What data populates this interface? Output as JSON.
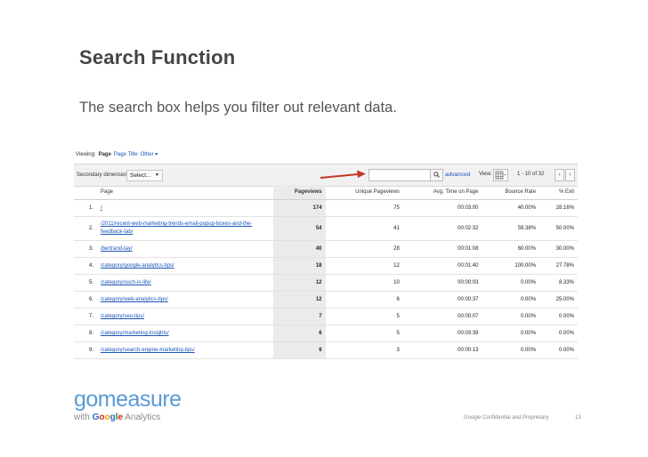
{
  "slide": {
    "title": "Search Function",
    "subtitle": "The search box helps you filter out relevant data."
  },
  "viewing": {
    "label": "Viewing:",
    "tab_page": "Page",
    "tab_page_title": "Page Title",
    "tab_other": "Other"
  },
  "filter_bar": {
    "secondary_dimension_label": "Secondary dimension:",
    "select_label": "Select...",
    "search_value": "",
    "advanced_label": "advanced",
    "view_label": "View:",
    "pager_text": "1 - 10 of 32"
  },
  "table": {
    "headers": [
      "Page",
      "Pageviews",
      "Unique Pageviews",
      "Avg. Time on Page",
      "Bounce Rate",
      "% Exit"
    ],
    "rows": [
      {
        "num": "1.",
        "page": "/",
        "pageviews": "174",
        "unique": "75",
        "avg_time": "00:03:00",
        "bounce": "40.00%",
        "exit": "28.16%"
      },
      {
        "num": "2.",
        "page": "/2011/recent-web-marketing-trends-email-popup-boxes-and-the-feedback-tab/",
        "pageviews": "54",
        "unique": "41",
        "avg_time": "00:02:32",
        "bounce": "59.38%",
        "exit": "50.00%"
      },
      {
        "num": "3.",
        "page": "/bertrand-tay/",
        "pageviews": "40",
        "unique": "28",
        "avg_time": "00:01:08",
        "bounce": "60.00%",
        "exit": "30.00%"
      },
      {
        "num": "4.",
        "page": "/category/google-analytics-tips/",
        "pageviews": "18",
        "unique": "12",
        "avg_time": "00:01:40",
        "bounce": "100.00%",
        "exit": "27.78%"
      },
      {
        "num": "5.",
        "page": "/category/such-is-life/",
        "pageviews": "12",
        "unique": "10",
        "avg_time": "00:00:03",
        "bounce": "0.00%",
        "exit": "8.33%"
      },
      {
        "num": "6.",
        "page": "/category/web-analytics-tips/",
        "pageviews": "12",
        "unique": "6",
        "avg_time": "00:00:37",
        "bounce": "0.00%",
        "exit": "25.00%"
      },
      {
        "num": "7.",
        "page": "/category/seo-tips/",
        "pageviews": "7",
        "unique": "5",
        "avg_time": "00:00:07",
        "bounce": "0.00%",
        "exit": "0.00%"
      },
      {
        "num": "8.",
        "page": "/category/marketing-insights/",
        "pageviews": "6",
        "unique": "5",
        "avg_time": "00:03:39",
        "bounce": "0.00%",
        "exit": "0.00%"
      },
      {
        "num": "9.",
        "page": "/category/search-engine-marketing-tips/",
        "pageviews": "6",
        "unique": "3",
        "avg_time": "00:00:13",
        "bounce": "0.00%",
        "exit": "0.00%"
      }
    ]
  },
  "logo": {
    "wordmark": "gomeasure",
    "tagline_with": "with",
    "google_letters": [
      "G",
      "o",
      "o",
      "g",
      "l",
      "e"
    ],
    "tagline_analytics": "Analytics"
  },
  "footer": {
    "note": "Google Confidential and Proprietary",
    "page_number": "13"
  },
  "colors": {
    "link": "#1a56b8",
    "arrow": "#c0392b",
    "logo_blue": "#5a9ad4"
  },
  "icons": {
    "search": "search-icon",
    "grid_view": "grid-view-icon",
    "arrow": "pointer-arrow-icon"
  }
}
